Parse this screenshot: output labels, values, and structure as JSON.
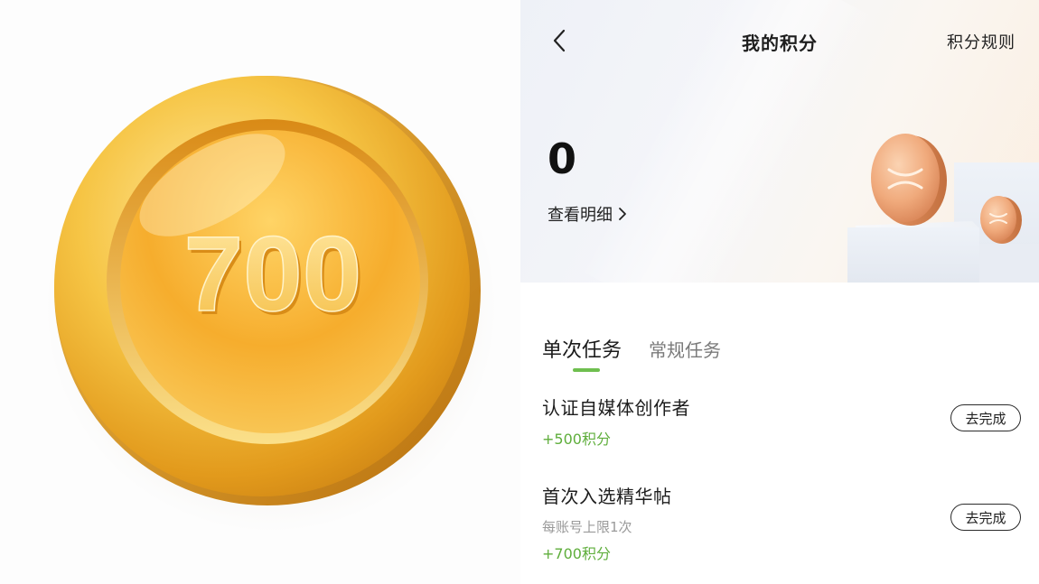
{
  "coin_image": {
    "value_text": "700"
  },
  "header": {
    "back_icon": "chevron-left-icon",
    "title": "我的积分",
    "rules_label": "积分规则"
  },
  "points": {
    "value": "0",
    "details_label": "查看明细"
  },
  "tabs": [
    {
      "label": "单次任务",
      "active": true
    },
    {
      "label": "常规任务",
      "active": false
    }
  ],
  "tasks": [
    {
      "title": "认证自媒体创作者",
      "limit": "",
      "reward": "+500积分",
      "button": "去完成"
    },
    {
      "title": "首次入选精华帖",
      "limit": "每账号上限1次",
      "reward": "+700积分",
      "button": "去完成"
    }
  ],
  "colors": {
    "accent_green": "#6fbf4f",
    "reward_green": "#5fae3c",
    "coin_gold": "#f2b52e"
  }
}
